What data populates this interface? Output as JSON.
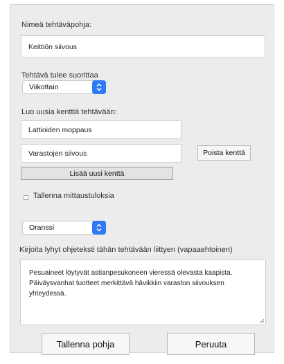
{
  "template_name": {
    "label": "Nimeä tehtäväpohja:",
    "value": "Keittiön siivous"
  },
  "frequency": {
    "label": "Tehtävä tulee suorittaa",
    "selected": "Viikottain"
  },
  "fields_section": {
    "label": "Luo uusia kenttiä tehtävään:",
    "fields": [
      "Lattioiden moppaus",
      "Varastojen siivous"
    ],
    "remove_button": "Poista kenttä",
    "add_button": "Lisää uusi kenttä"
  },
  "measurements": {
    "label": "Tallenna mittaustuloksia",
    "checked": false
  },
  "color": {
    "selected": "Oranssi"
  },
  "instructions": {
    "label": "Kirjoita lyhyt ohjeteksti tähän tehtävään liittyen (vapaaehtoinen)",
    "lines": [
      "Pesuaineet löytyvät astianpesukoneen vieressä olevasta kaapista.",
      "Päiväysvanhat tuotteet merkittävä hävikkiin varaston siivouksen",
      "yhteydessä."
    ]
  },
  "actions": {
    "save": "Tallenna pohja",
    "cancel": "Peruuta"
  },
  "colors": {
    "accent": "#2f7bf5",
    "panel": "#ececec"
  }
}
